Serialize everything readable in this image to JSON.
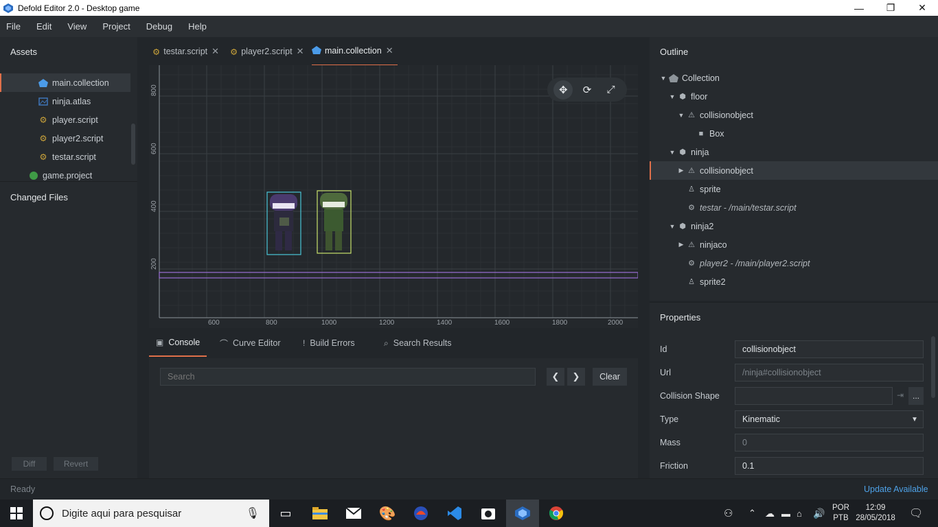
{
  "window": {
    "title": "Defold Editor 2.0 - Desktop game",
    "minimize": "—",
    "maximize": "❐",
    "close": "✕"
  },
  "menu": [
    "File",
    "Edit",
    "View",
    "Project",
    "Debug",
    "Help"
  ],
  "assets": {
    "header": "Assets",
    "items": [
      {
        "label": "main.collection",
        "icon": "collection-icon"
      },
      {
        "label": "ninja.atlas",
        "icon": "atlas-icon"
      },
      {
        "label": "player.script",
        "icon": "script-gear-icon"
      },
      {
        "label": "player2.script",
        "icon": "script-gear-icon"
      },
      {
        "label": "testar.script",
        "icon": "script-gear-icon"
      },
      {
        "label": "game.project",
        "icon": "project-icon"
      }
    ]
  },
  "changed_files": {
    "header": "Changed Files",
    "diff": "Diff",
    "revert": "Revert"
  },
  "editor_tabs": [
    {
      "label": "testar.script",
      "close": "✕"
    },
    {
      "label": "player2.script",
      "close": "✕"
    },
    {
      "label": "main.collection",
      "close": "✕"
    }
  ],
  "viewport": {
    "y_ticks": [
      "800",
      "600",
      "400",
      "200"
    ],
    "x_ticks": [
      "600",
      "800",
      "1000",
      "1200",
      "1400",
      "1600",
      "1800",
      "2000"
    ],
    "tools": {
      "move": "✥",
      "rotate": "⟳",
      "scale": "⤢"
    }
  },
  "console": {
    "tabs": [
      {
        "label": "Console",
        "icon": "console-icon"
      },
      {
        "label": "Curve Editor",
        "icon": "curve-icon"
      },
      {
        "label": "Build Errors",
        "icon": "error-icon"
      },
      {
        "label": "Search Results",
        "icon": "search-icon"
      }
    ],
    "search_placeholder": "Search",
    "prev": "❮",
    "next": "❯",
    "clear": "Clear"
  },
  "outline": {
    "header": "Outline",
    "items": [
      {
        "label": "Collection",
        "twisty": "▼"
      },
      {
        "label": "floor",
        "twisty": "▼"
      },
      {
        "label": "collisionobject",
        "twisty": "▼"
      },
      {
        "label": "Box",
        "twisty": ""
      },
      {
        "label": "ninja",
        "twisty": "▼"
      },
      {
        "label": "collisionobject",
        "twisty": "▶"
      },
      {
        "label": "sprite",
        "twisty": ""
      },
      {
        "label": "testar - /main/testar.script",
        "twisty": ""
      },
      {
        "label": "ninja2",
        "twisty": "▼"
      },
      {
        "label": "ninjaco",
        "twisty": "▶"
      },
      {
        "label": "player2 - /main/player2.script",
        "twisty": ""
      },
      {
        "label": "sprite2",
        "twisty": ""
      }
    ]
  },
  "properties": {
    "header": "Properties",
    "fields": [
      {
        "label": "Id",
        "value": "collisionobject"
      },
      {
        "label": "Url",
        "value": "/ninja#collisionobject"
      },
      {
        "label": "Collision Shape",
        "value": ""
      },
      {
        "label": "Type",
        "value": "Kinematic"
      },
      {
        "label": "Mass",
        "value": "0"
      },
      {
        "label": "Friction",
        "value": "0.1"
      }
    ],
    "browse": "...",
    "goto": "⇥",
    "dropdown": "▼"
  },
  "status": {
    "text": "Ready",
    "update": "Update Available"
  },
  "taskbar": {
    "search_placeholder": "Digite aqui para pesquisar",
    "lang1": "POR",
    "lang2": "PTB",
    "time": "12:09",
    "date": "28/05/2018"
  }
}
